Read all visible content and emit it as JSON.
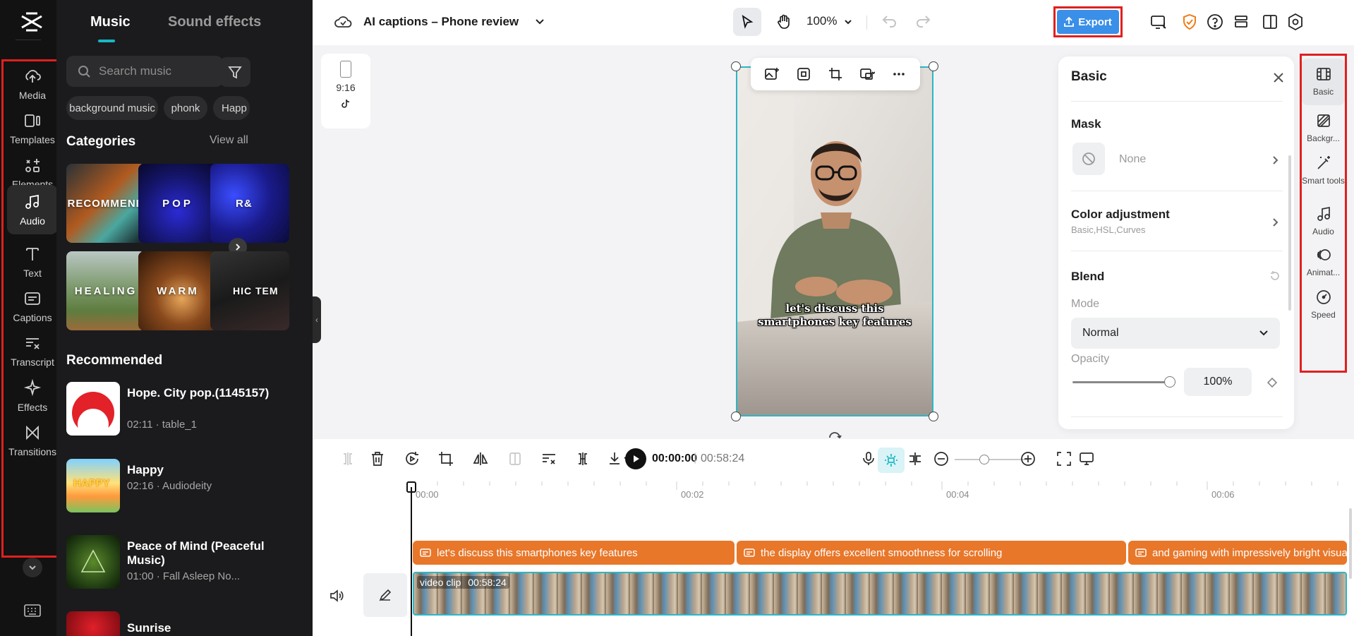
{
  "nav": {
    "items": [
      {
        "label": "Media",
        "icon": "cloud-upload-icon"
      },
      {
        "label": "Templates",
        "icon": "templates-icon"
      },
      {
        "label": "Elements",
        "icon": "elements-icon"
      },
      {
        "label": "Audio",
        "icon": "music-note-icon",
        "active": true
      },
      {
        "label": "Text",
        "icon": "text-icon"
      },
      {
        "label": "Captions",
        "icon": "captions-icon"
      },
      {
        "label": "Transcript",
        "icon": "transcript-icon"
      },
      {
        "label": "Effects",
        "icon": "effects-icon"
      },
      {
        "label": "Transitions",
        "icon": "transitions-icon"
      }
    ]
  },
  "music": {
    "tabs": [
      "Music",
      "Sound effects"
    ],
    "search_placeholder": "Search music",
    "chips": [
      "background music",
      "phonk",
      "Happ"
    ],
    "categories_title": "Categories",
    "view_all": "View all",
    "categories": [
      "RECOMMEND",
      "POP",
      "R&",
      "HEALING",
      "WARM",
      "HIC TEM"
    ],
    "recommended_title": "Recommended",
    "tracks": [
      {
        "title": "Hope. City pop.(1145157)",
        "meta": "02:11 · table_1"
      },
      {
        "title": "Happy",
        "meta": "02:16 · Audiodeity"
      },
      {
        "title": "Peace of Mind (Peaceful Music)",
        "meta": "01:00 · Fall Asleep No..."
      },
      {
        "title": "Sunrise",
        "meta": ""
      }
    ]
  },
  "topbar": {
    "project_title": "AI captions – Phone review",
    "zoom": "100%",
    "export_label": "Export"
  },
  "canvas": {
    "aspect": "9:16",
    "subtitle_line1": "let's discuss this",
    "subtitle_line2": "smartphones key features"
  },
  "basic_panel": {
    "title": "Basic",
    "mask_title": "Mask",
    "mask_value": "None",
    "color_title": "Color adjustment",
    "color_sub": "Basic,HSL,Curves",
    "blend_title": "Blend",
    "mode_label": "Mode",
    "mode_value": "Normal",
    "opacity_label": "Opacity",
    "opacity_value": "100%"
  },
  "rail": {
    "items": [
      {
        "label": "Basic",
        "icon": "film-icon",
        "active": true
      },
      {
        "label": "Backgr...",
        "icon": "background-icon"
      },
      {
        "label": "Smart tools",
        "icon": "magic-wand-icon"
      },
      {
        "label": "Audio",
        "icon": "music-note-icon"
      },
      {
        "label": "Animat...",
        "icon": "animation-icon"
      },
      {
        "label": "Speed",
        "icon": "speed-icon"
      }
    ]
  },
  "timeline": {
    "current_time": "00:00:00",
    "separator": "|",
    "total_time": "00:58:24",
    "ruler_labels": [
      "00:00",
      "00:02",
      "00:04",
      "00:06"
    ],
    "caption_clips": [
      "let's discuss this smartphones key features",
      "the display offers excellent smoothness for scrolling",
      "and gaming with impressively bright visuals"
    ],
    "video_label": "video clip",
    "video_duration": "00:58:24"
  },
  "colors": {
    "accent": "#19b6c6",
    "export": "#3a8fe8",
    "caption_clip": "#e8772a",
    "highlight_box": "#e0201e"
  }
}
